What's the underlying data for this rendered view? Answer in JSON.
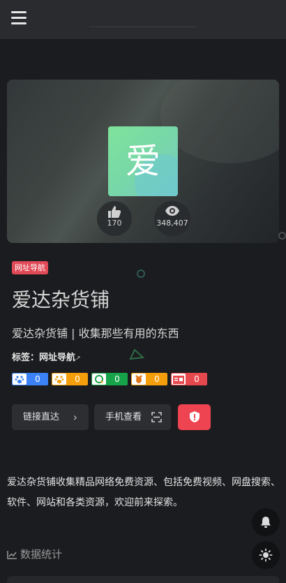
{
  "site": {
    "badge": "网址导航",
    "title": "爱达杂货铺",
    "subtitle": "爱达杂货铺 | 收集那些有用的东西",
    "logo_char": "爱"
  },
  "stats": {
    "likes": "170",
    "views": "348,407"
  },
  "tags": {
    "label": "标签：",
    "items": [
      "网址导航"
    ]
  },
  "engines": [
    {
      "name": "baidu-icon",
      "value": "0",
      "color": "#3b82f6"
    },
    {
      "name": "pawprint-icon",
      "value": "0",
      "color": "#f59e0b"
    },
    {
      "name": "so360-icon",
      "value": "0",
      "color": "#16a34a"
    },
    {
      "name": "sogou-icon",
      "value": "0",
      "color": "#f59e0b"
    },
    {
      "name": "toutiao-icon",
      "value": "0",
      "color": "#e5484d"
    }
  ],
  "buttons": {
    "direct": "链接直达",
    "mobile": "手机查看"
  },
  "description": "爱达杂货铺收集精品网络免费资源、包括免费视频、网盘搜索、软件、网站和各类资源，欢迎前来探索。",
  "stats_section": {
    "title": "数据统计"
  },
  "colors": {
    "background": "#1b1c1f",
    "badge": "#e04a57",
    "report_button": "#ee4351"
  }
}
